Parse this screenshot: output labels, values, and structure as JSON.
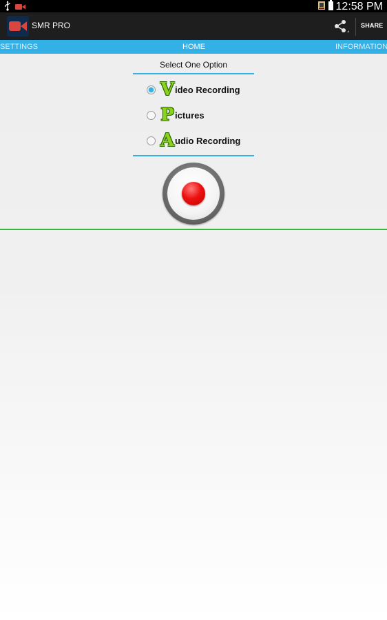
{
  "status_bar": {
    "time": "12:58 PM",
    "left_icons": [
      "usb-icon",
      "video-camera-icon"
    ],
    "right_icons": [
      "notification-icon",
      "battery-icon"
    ]
  },
  "action_bar": {
    "app_title": "SMR PRO",
    "app_icon": "video-camera-icon",
    "share_label": "SHARE",
    "share_icon": "share-icon"
  },
  "tabs": [
    {
      "label": "SETTINGS",
      "active": false
    },
    {
      "label": "HOME",
      "active": true
    },
    {
      "label": "INFORMATION",
      "active": false
    }
  ],
  "options_panel": {
    "title": "Select One Option",
    "options": [
      {
        "letter": "V",
        "rest": "ideo Recording",
        "selected": true
      },
      {
        "letter": "P",
        "rest": "ictures",
        "selected": false
      },
      {
        "letter": "A",
        "rest": "udio Recording",
        "selected": false
      }
    ]
  },
  "record_button": {
    "icon": "record-icon"
  },
  "colors": {
    "accent": "#33b0e5",
    "action_bar": "#1e1e1e",
    "divider_green": "#38b53a",
    "record_red": "#ee1111",
    "letter_green": "#8cd21c"
  }
}
